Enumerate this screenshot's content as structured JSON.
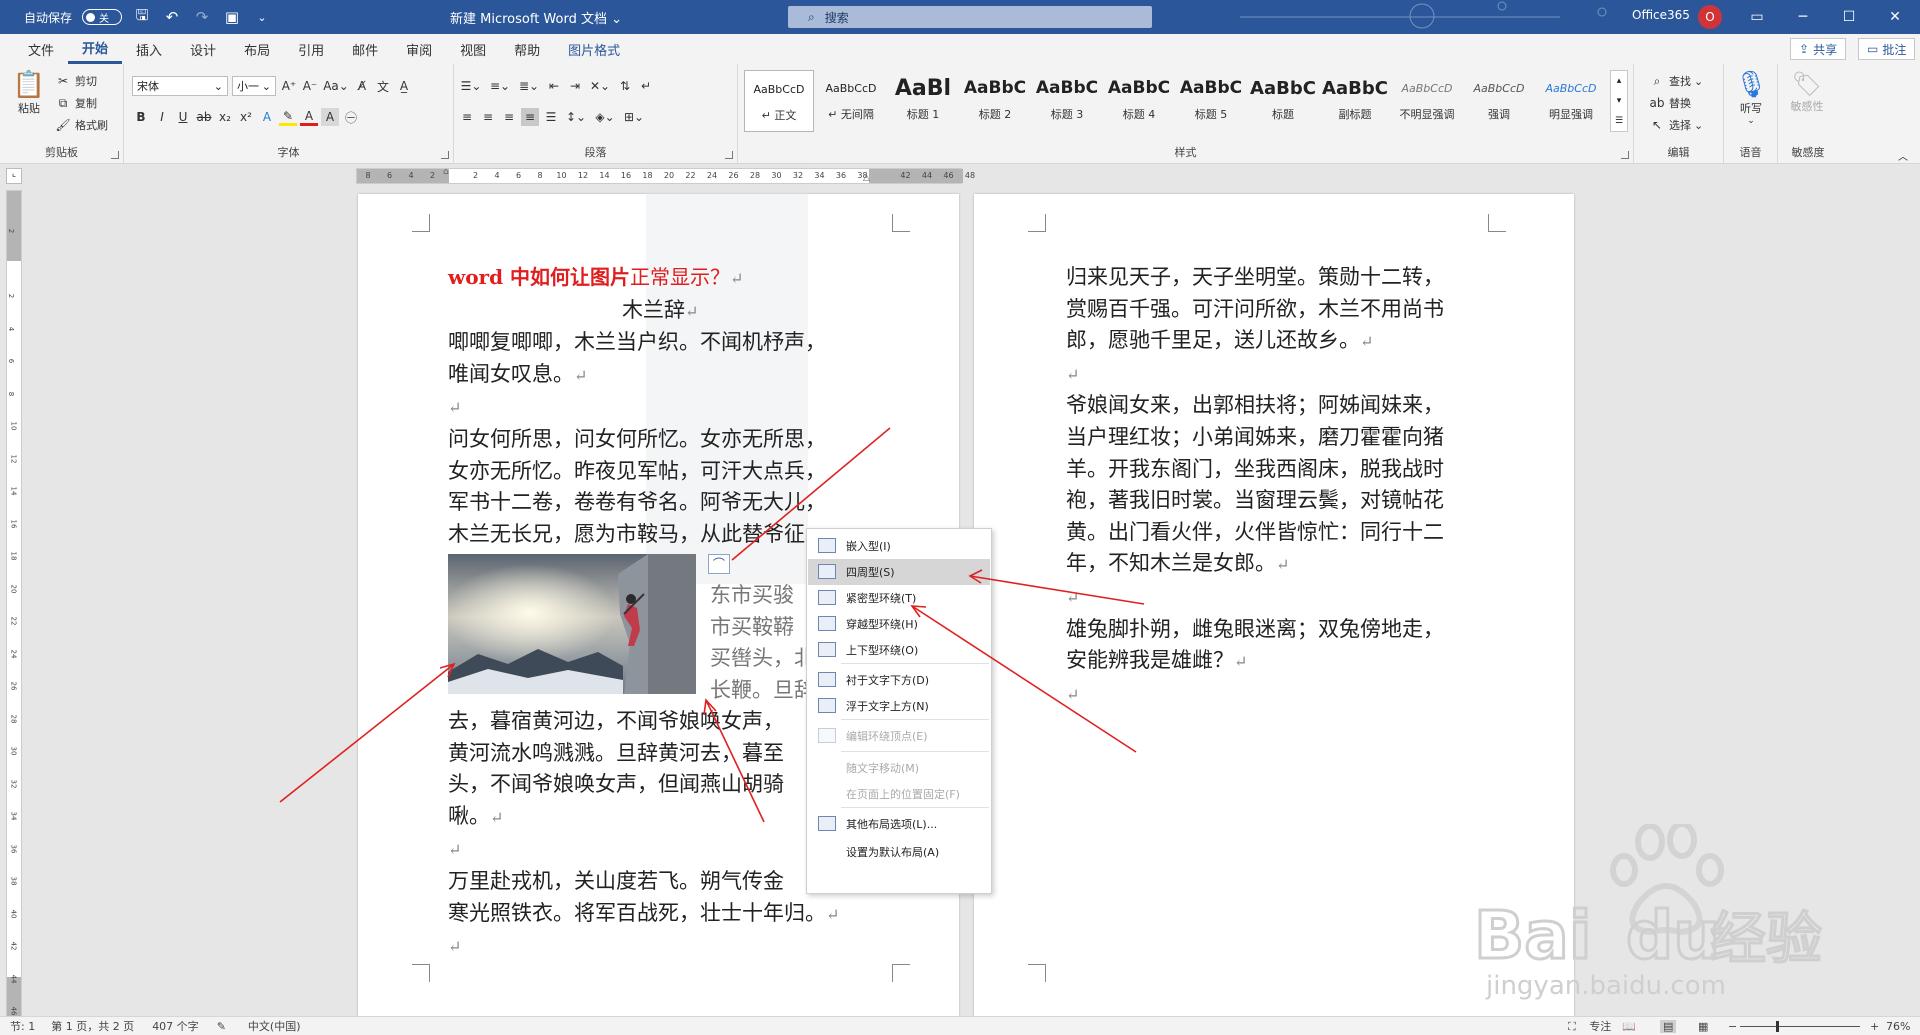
{
  "titlebar": {
    "autosave_label": "自动保存",
    "autosave_state": "关",
    "doc_title": "新建 Microsoft Word 文档",
    "doc_title_caret": "⌄",
    "search_placeholder": "搜索",
    "account_name": "Office365",
    "avatar_initial": "O"
  },
  "tabs": [
    "文件",
    "开始",
    "插入",
    "设计",
    "布局",
    "引用",
    "邮件",
    "审阅",
    "视图",
    "帮助",
    "图片格式"
  ],
  "share_label": "共享",
  "comment_label": "批注",
  "ribbon": {
    "clipboard": {
      "paste": "粘贴",
      "cut": "剪切",
      "copy": "复制",
      "format_painter": "格式刷",
      "label": "剪贴板"
    },
    "font": {
      "name": "宋体",
      "size": "小一",
      "label": "字体"
    },
    "paragraph": {
      "label": "段落"
    },
    "styles": {
      "label": "样式",
      "items": [
        {
          "sample": "AaBbCcD",
          "name": "↵ 正文"
        },
        {
          "sample": "AaBbCcD",
          "name": "↵ 无间隔"
        },
        {
          "sample": "AaBl",
          "name": "标题 1"
        },
        {
          "sample": "AaBbC",
          "name": "标题 2"
        },
        {
          "sample": "AaBbC",
          "name": "标题 3"
        },
        {
          "sample": "AaBbC",
          "name": "标题 4"
        },
        {
          "sample": "AaBbC",
          "name": "标题 5"
        },
        {
          "sample": "AaBbC",
          "name": "标题"
        },
        {
          "sample": "AaBbC",
          "name": "副标题"
        },
        {
          "sample": "AaBbCcD",
          "name": "不明显强调"
        },
        {
          "sample": "AaBbCcD",
          "name": "强调"
        },
        {
          "sample": "AaBbCcD",
          "name": "明显强调"
        }
      ]
    },
    "editing": {
      "find": "查找",
      "replace": "替换",
      "select": "选择",
      "label": "编辑"
    },
    "voice": {
      "dictate": "听写",
      "label": "语音"
    },
    "sensitivity": {
      "button": "敏感性",
      "label": "敏感度"
    }
  },
  "hruler_ticks": [
    "8",
    "6",
    "4",
    "2",
    "",
    "2",
    "4",
    "6",
    "8",
    "10",
    "12",
    "14",
    "16",
    "18",
    "20",
    "22",
    "24",
    "26",
    "28",
    "30",
    "32",
    "34",
    "36",
    "38",
    "",
    "42",
    "44",
    "46",
    "48"
  ],
  "vruler_ticks": [
    "2",
    "",
    "2",
    "4",
    "6",
    "8",
    "10",
    "12",
    "14",
    "16",
    "18",
    "20",
    "22",
    "24",
    "26",
    "28",
    "30",
    "32",
    "34",
    "36",
    "38",
    "40",
    "42",
    "44",
    "46"
  ],
  "page1": {
    "title_part1": "word 中如何让图片",
    "title_part2": "正常显示？",
    "subtitle": "木兰辞",
    "lines": [
      "唧唧复唧唧，木兰当户织。不闻机杼声，",
      "唯闻女叹息。",
      "",
      "问女何所思，问女何所忆。女亦无所思，",
      "女亦无所忆。昨夜见军帖，可汗大点兵，",
      "军书十二卷，卷卷有爷名。阿爷无大儿，",
      "木兰无长兄，愿为市鞍马，从此替爷征。"
    ],
    "beside_image": [
      "东市买骏",
      "市买鞍鞯",
      "买辔头，北",
      "长鞭。旦辞"
    ],
    "after_image": [
      "去，暮宿黄河边，不闻爷娘唤女声，",
      "黄河流水鸣溅溅。旦辞黄河去，暮至",
      "头，不闻爷娘唤女声，但闻燕山胡骑",
      "啾。",
      "",
      "万里赴戎机，关山度若飞。朔气传金",
      "寒光照铁衣。将军百战死，壮士十年归。",
      ""
    ]
  },
  "page2": {
    "lines": [
      "归来见天子，天子坐明堂。策勋十二转，",
      "赏赐百千强。可汗问所欲，木兰不用尚书",
      "郎，愿驰千里足，送儿还故乡。",
      "",
      "爷娘闻女来，出郭相扶将；阿姊闻妹来，",
      "当户理红妆；小弟闻姊来，磨刀霍霍向猪",
      "羊。开我东阁门，坐我西阁床，脱我战时",
      "袍，著我旧时裳。当窗理云鬓，对镜帖花",
      "黄。出门看火伴，火伴皆惊忙：同行十二",
      "年，不知木兰是女郎。",
      "",
      "雄兔脚扑朔，雌兔眼迷离；双兔傍地走，",
      "安能辨我是雄雌？",
      ""
    ]
  },
  "context_menu": [
    {
      "label": "嵌入型(I)",
      "state": "normal"
    },
    {
      "label": "四周型(S)",
      "state": "highlight"
    },
    {
      "label": "紧密型环绕(T)",
      "state": "normal"
    },
    {
      "label": "穿越型环绕(H)",
      "state": "normal"
    },
    {
      "label": "上下型环绕(O)",
      "state": "normal"
    },
    {
      "label": "衬于文字下方(D)",
      "state": "normal"
    },
    {
      "label": "浮于文字上方(N)",
      "state": "normal"
    },
    {
      "label": "编辑环绕顶点(E)",
      "state": "disabled"
    },
    {
      "label": "随文字移动(M)",
      "state": "disabled"
    },
    {
      "label": "在页面上的位置固定(F)",
      "state": "disabled"
    },
    {
      "label": "其他布局选项(L)...",
      "state": "normal"
    },
    {
      "label": "设置为默认布局(A)",
      "state": "normal"
    }
  ],
  "statusbar": {
    "section": "节: 1",
    "page": "第 1 页，共 2 页",
    "words": "407 个字",
    "language": "中文(中国)",
    "focus": "专注",
    "zoom": "76%"
  },
  "watermark": {
    "brand_a": "Bai",
    "brand_b": "du",
    "brand_cn": "经验",
    "url": "jingyan.baidu.com"
  },
  "colors": {
    "word_blue": "#2b579a",
    "arrow_red": "#e02020",
    "title_red": "#e01e1e"
  }
}
